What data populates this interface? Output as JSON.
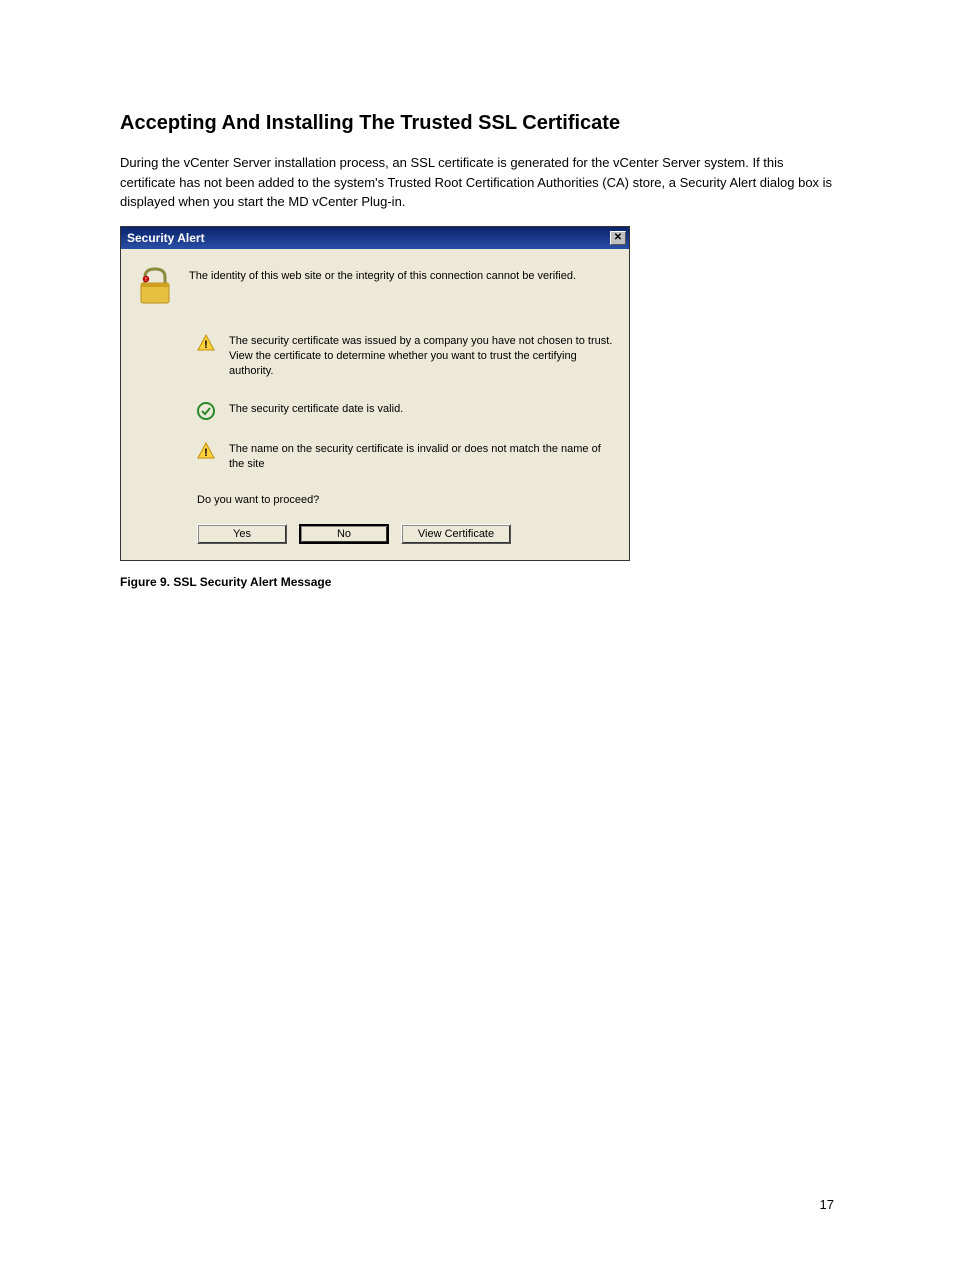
{
  "heading": "Accepting And Installing The Trusted SSL Certificate",
  "paragraph": "During the vCenter Server installation process, an SSL certificate is generated for the vCenter Server system. If this certificate has not been added to the system's Trusted Root Certification Authorities (CA) store, a Security Alert dialog box is displayed when you start the MD vCenter Plug-in.",
  "dialog": {
    "title": "Security Alert",
    "intro": "The identity of this web site or the integrity of this connection cannot be verified.",
    "bullets": [
      "The security certificate was issued by a company you have not chosen to trust. View the certificate to determine whether you want to trust the certifying authority.",
      "The security certificate date is valid.",
      "The name on the security certificate is invalid or does not match the name of the site"
    ],
    "prompt": "Do you want to proceed?",
    "buttons": {
      "yes": "Yes",
      "no": "No",
      "view_cert": "View Certificate"
    }
  },
  "figure_caption": "Figure 9. SSL Security Alert Message",
  "page_number": "17"
}
